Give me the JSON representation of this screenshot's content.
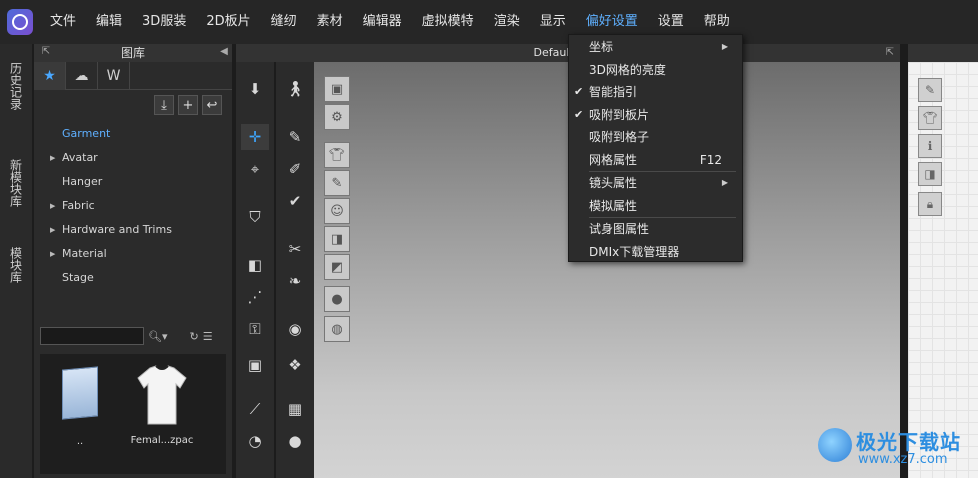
{
  "menubar": {
    "items": [
      "文件",
      "编辑",
      "3D服装",
      "2D板片",
      "缝纫",
      "素材",
      "编辑器",
      "虚拟模特",
      "渲染",
      "显示",
      "偏好设置",
      "设置",
      "帮助"
    ],
    "active_index": 10
  },
  "vtabs": [
    "历史记录",
    "新模块库",
    "模块库"
  ],
  "library": {
    "title": "图库",
    "tree": [
      {
        "label": "Garment",
        "expandable": false,
        "selected": true
      },
      {
        "label": "Avatar",
        "expandable": true
      },
      {
        "label": "Hanger",
        "expandable": false
      },
      {
        "label": "Fabric",
        "expandable": true
      },
      {
        "label": "Hardware and Trims",
        "expandable": true
      },
      {
        "label": "Material",
        "expandable": true
      },
      {
        "label": "Stage",
        "expandable": false
      }
    ],
    "files": [
      {
        "label": ".."
      },
      {
        "label": "Femal...zpac"
      }
    ]
  },
  "viewport": {
    "title": "Default_Mod"
  },
  "dropdown": {
    "items": [
      {
        "label": "坐标",
        "submenu": true,
        "checked": false
      },
      {
        "label": "3D网格的亮度",
        "submenu": false,
        "checked": false
      },
      {
        "label": "智能指引",
        "submenu": false,
        "checked": true
      },
      {
        "label": "吸附到板片",
        "submenu": false,
        "checked": true
      },
      {
        "label": "吸附到格子",
        "submenu": false,
        "checked": false
      },
      {
        "label": "网格属性",
        "submenu": false,
        "checked": false,
        "shortcut": "F12"
      },
      {
        "label": "镜头属性",
        "submenu": true,
        "checked": false
      },
      {
        "label": "模拟属性",
        "submenu": false,
        "checked": false
      },
      {
        "label": "试身图属性",
        "submenu": false,
        "checked": false
      },
      {
        "label": "DMIx下载管理器",
        "submenu": false,
        "checked": false
      }
    ]
  },
  "watermark": {
    "name": "极光下载站",
    "url": "www.xz7.com"
  },
  "colors": {
    "accent": "#5fb0ff",
    "menubar": "#262626",
    "panel": "#2b2b2b"
  }
}
